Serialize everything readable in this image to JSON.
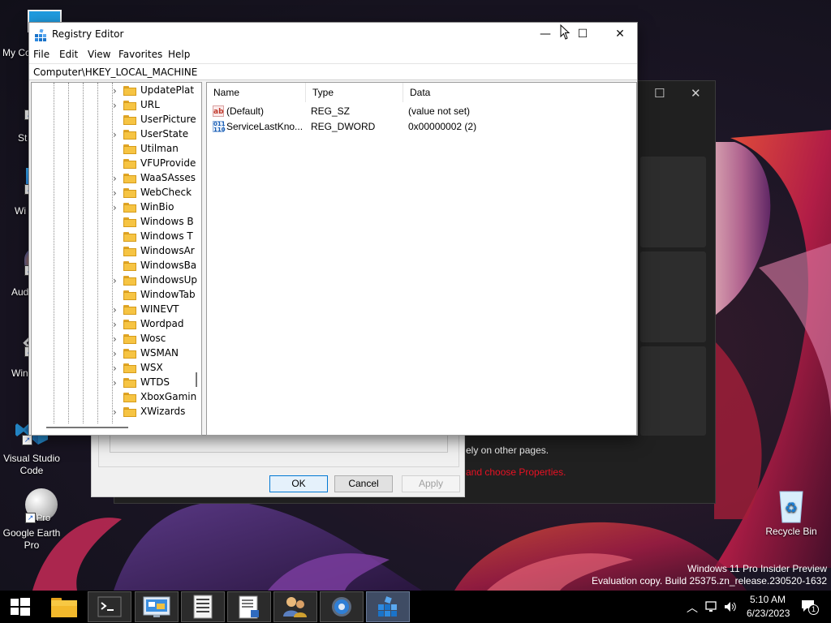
{
  "desktop": {
    "icons": [
      {
        "label": "My Co"
      },
      {
        "label": "St"
      },
      {
        "label": "Wi"
      },
      {
        "label": "Aud"
      },
      {
        "label": "Win"
      },
      {
        "label": "Visual Studio Code"
      },
      {
        "label": "Google Earth Pro"
      },
      {
        "label": "Recycle Bin"
      }
    ],
    "pro_badge": "Pro",
    "watermark": {
      "line1": "Windows 11 Pro Insider Preview",
      "line2": "Evaluation copy. Build 25375.zn_release.230520-1632"
    }
  },
  "background_windows": {
    "settings_text_1": "ely on other pages.",
    "settings_text_2": "and choose Properties.",
    "dialog": {
      "ok_label": "OK",
      "cancel_label": "Cancel",
      "apply_label": "Apply"
    }
  },
  "regedit": {
    "title": "Registry Editor",
    "window_controls": {
      "minimize": "—",
      "maximize": "☐",
      "close": "✕"
    },
    "menu": [
      "File",
      "Edit",
      "View",
      "Favorites",
      "Help"
    ],
    "address": "Computer\\HKEY_LOCAL_MACHINE",
    "tree_items": [
      {
        "label": "UpdatePlat",
        "expandable": true
      },
      {
        "label": "URL",
        "expandable": true
      },
      {
        "label": "UserPicture",
        "expandable": false
      },
      {
        "label": "UserState",
        "expandable": true
      },
      {
        "label": "Utilman",
        "expandable": false
      },
      {
        "label": "VFUProvide",
        "expandable": false
      },
      {
        "label": "WaaSAsses",
        "expandable": true
      },
      {
        "label": "WebCheck",
        "expandable": true
      },
      {
        "label": "WinBio",
        "expandable": true
      },
      {
        "label": "Windows B",
        "expandable": false
      },
      {
        "label": "Windows T",
        "expandable": false
      },
      {
        "label": "WindowsAr",
        "expandable": false
      },
      {
        "label": "WindowsBa",
        "expandable": false
      },
      {
        "label": "WindowsUp",
        "expandable": true
      },
      {
        "label": "WindowTab",
        "expandable": false
      },
      {
        "label": "WINEVT",
        "expandable": true
      },
      {
        "label": "Wordpad",
        "expandable": true
      },
      {
        "label": "Wosc",
        "expandable": true
      },
      {
        "label": "WSMAN",
        "expandable": true
      },
      {
        "label": "WSX",
        "expandable": true
      },
      {
        "label": "WTDS",
        "expandable": true
      },
      {
        "label": "XboxGamin",
        "expandable": false
      },
      {
        "label": "XWizards",
        "expandable": true
      }
    ],
    "columns": {
      "name": "Name",
      "type": "Type",
      "data": "Data"
    },
    "values": [
      {
        "icon": "string-value-icon",
        "name": "(Default)",
        "type": "REG_SZ",
        "data": "(value not set)"
      },
      {
        "icon": "dword-value-icon",
        "name": "ServiceLastKno...",
        "type": "REG_DWORD",
        "data": "0x00000002 (2)"
      }
    ]
  },
  "taskbar": {
    "apps": [
      {
        "icon": "start-icon"
      },
      {
        "icon": "file-explorer-icon"
      },
      {
        "icon": "terminal-icon"
      },
      {
        "icon": "remote-desktop-icon"
      },
      {
        "icon": "ui-settings-icon"
      },
      {
        "icon": "document-icon"
      },
      {
        "icon": "users-icon"
      },
      {
        "icon": "settings-gear-icon"
      },
      {
        "icon": "registry-editor-icon"
      }
    ],
    "clock": {
      "time": "5:10 AM",
      "date": "6/23/2023"
    },
    "notification_count": "1"
  }
}
